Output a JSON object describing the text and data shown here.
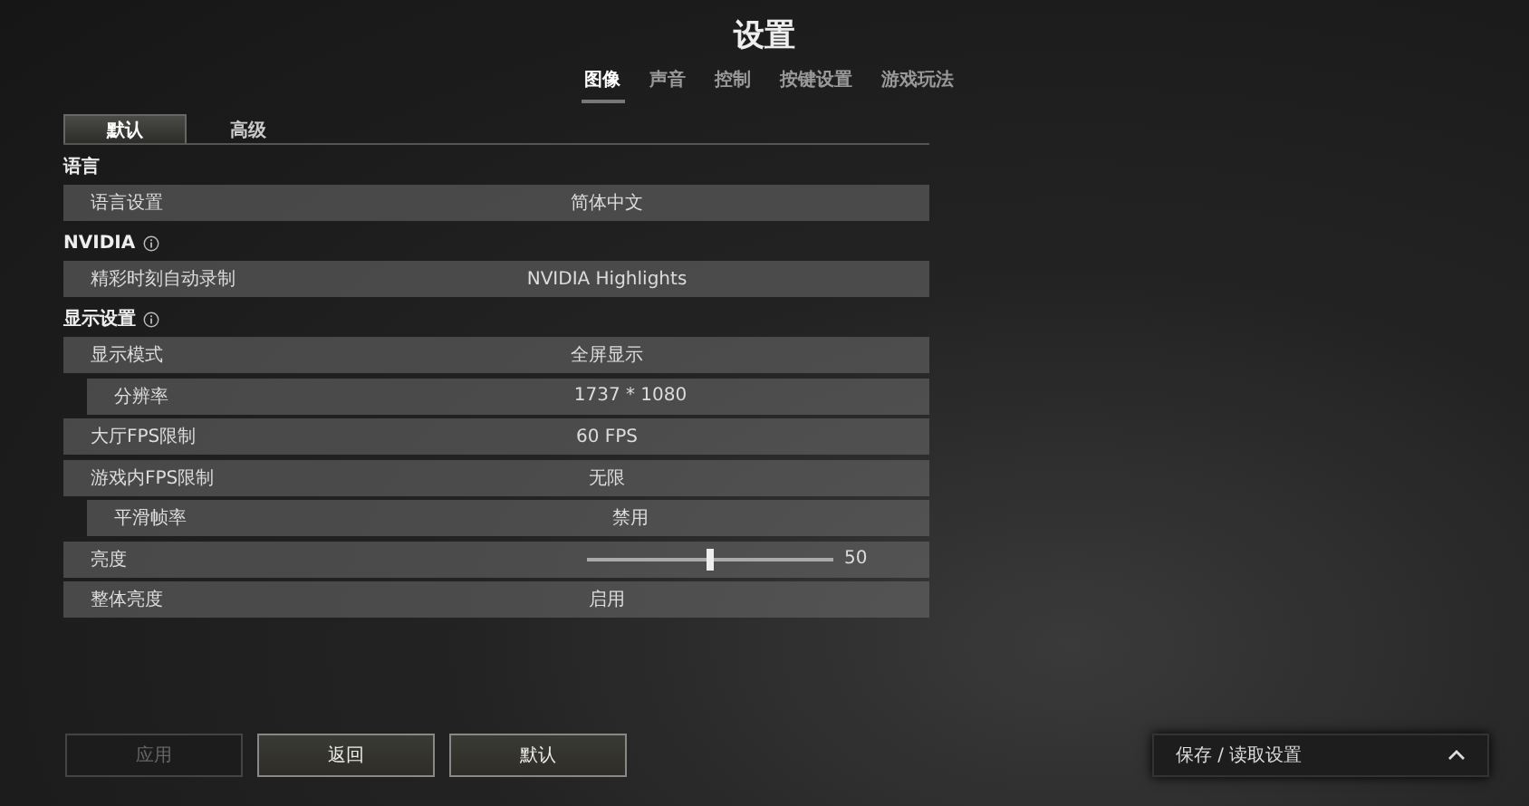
{
  "title": "设置",
  "tabs": [
    {
      "label": "图像",
      "selected": true
    },
    {
      "label": "声音",
      "selected": false
    },
    {
      "label": "控制",
      "selected": false
    },
    {
      "label": "按键设置",
      "selected": false
    },
    {
      "label": "游戏玩法",
      "selected": false
    }
  ],
  "subtabs": [
    {
      "label": "默认",
      "selected": true
    },
    {
      "label": "高级",
      "selected": false
    }
  ],
  "sections": [
    {
      "heading": "语言",
      "info": false,
      "rows": [
        {
          "kind": "value",
          "label": "语言设置",
          "value": "简体中文",
          "indented": false
        }
      ]
    },
    {
      "heading": "NVIDIA",
      "info": true,
      "rows": [
        {
          "kind": "value",
          "label": "精彩时刻自动录制",
          "value": "NVIDIA Highlights",
          "indented": false
        }
      ]
    },
    {
      "heading": "显示设置",
      "info": true,
      "rows": [
        {
          "kind": "value",
          "label": "显示模式",
          "value": "全屏显示",
          "indented": false
        },
        {
          "kind": "value",
          "label": "分辨率",
          "value": "1737 * 1080",
          "indented": true
        },
        {
          "kind": "value",
          "label": "大厅FPS限制",
          "value": "60 FPS",
          "indented": false
        },
        {
          "kind": "value",
          "label": "游戏内FPS限制",
          "value": "无限",
          "indented": false
        },
        {
          "kind": "value",
          "label": "平滑帧率",
          "value": "禁用",
          "indented": true
        },
        {
          "kind": "slider",
          "label": "亮度",
          "level": 0.5,
          "value": "50",
          "indented": false
        },
        {
          "kind": "value",
          "label": "整体亮度",
          "value": "启用",
          "indented": false
        }
      ]
    }
  ],
  "buttons": [
    {
      "label": "应用",
      "disabled": true
    },
    {
      "label": "返回",
      "disabled": false
    },
    {
      "label": "默认",
      "disabled": false
    }
  ],
  "save_panel": {
    "label": "保存 / 读取设置",
    "expanded": false
  }
}
